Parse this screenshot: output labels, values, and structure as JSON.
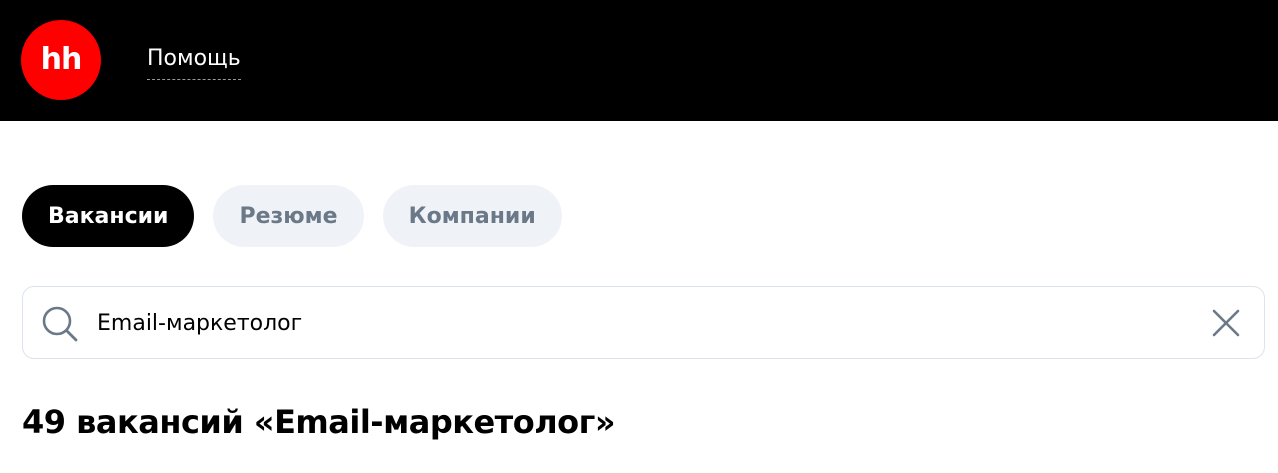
{
  "header": {
    "logo_text": "hh",
    "help_label": "Помощь"
  },
  "tabs": [
    {
      "label": "Вакансии",
      "active": true
    },
    {
      "label": "Резюме",
      "active": false
    },
    {
      "label": "Компании",
      "active": false
    }
  ],
  "search": {
    "value": "Email-маркетолог",
    "icon": "search-icon",
    "clear_icon": "close-icon"
  },
  "results": {
    "title": "49 вакансий «Email-маркетолог»"
  },
  "colors": {
    "header_bg": "#000000",
    "logo_bg": "#ff0000",
    "tab_active_bg": "#000000",
    "tab_inactive_bg": "#eff3f7",
    "tab_inactive_text": "#6a7888",
    "icon_color": "#6a7888"
  }
}
